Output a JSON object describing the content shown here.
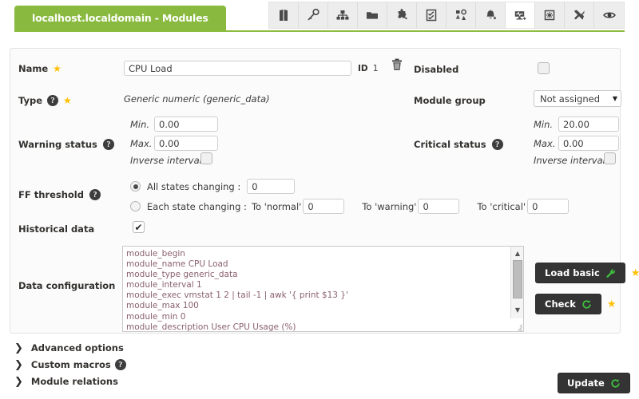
{
  "header": {
    "title": "localhost.localdomain - Modules",
    "accent_green": "#89ba3f",
    "toolbar_icons": [
      {
        "name": "bank-icon",
        "label": "Monitoring"
      },
      {
        "name": "key-icon",
        "label": "Credentials"
      },
      {
        "name": "network-icon",
        "label": "Network"
      },
      {
        "name": "folder-icon",
        "label": "Resources"
      },
      {
        "name": "puzzle-icon",
        "label": "Extensions"
      },
      {
        "name": "checklist-icon",
        "label": "Tasks"
      },
      {
        "name": "servers-alert-icon",
        "label": "Alerts"
      },
      {
        "name": "bell-plus-icon",
        "label": "Add alert"
      },
      {
        "name": "monitor-plus-icon",
        "label": "Add module",
        "active": true
      },
      {
        "name": "gear-box-icon",
        "label": "Setup"
      },
      {
        "name": "tools-icon",
        "label": "Tools"
      },
      {
        "name": "eye-icon",
        "label": "View"
      }
    ]
  },
  "form": {
    "name": {
      "label": "Name",
      "required_star": "★",
      "value": "CPU Load",
      "placeholder": "",
      "id_label": "ID",
      "id_value": "1",
      "delete_icon": "trash-icon"
    },
    "disabled": {
      "label": "Disabled",
      "checked": false
    },
    "type": {
      "label": "Type",
      "help": "?",
      "required_star": "★",
      "value": "Generic numeric (generic_data)"
    },
    "module_group": {
      "label": "Module group",
      "value": "Not assigned",
      "arrow": "▼"
    },
    "warning_status": {
      "label": "Warning status",
      "help": "?",
      "min_label": "Min.",
      "min_value": "0.00",
      "max_label": "Max.",
      "max_value": "0.00",
      "inverse_label": "Inverse interval",
      "inverse_checked": false
    },
    "critical_status": {
      "label": "Critical status",
      "help": "?",
      "min_label": "Min.",
      "min_value": "20.00",
      "max_label": "Max.",
      "max_value": "0.00",
      "inverse_label": "Inverse interval",
      "inverse_checked": false
    },
    "ff_threshold": {
      "label": "FF threshold",
      "help": "?",
      "all_states_label": "All states changing :",
      "all_states_value": "0",
      "all_states_selected": true,
      "each_state_label": "Each state changing :",
      "each_state_selected": false,
      "to_normal_label": "To 'normal'",
      "to_normal_value": "0",
      "to_warning_label": "To 'warning'",
      "to_warning_value": "0",
      "to_critical_label": "To 'critical'",
      "to_critical_value": "0"
    },
    "historical_data": {
      "label": "Historical data",
      "checked": true,
      "tick": "✔"
    },
    "data_configuration": {
      "label": "Data configuration",
      "value": "module_begin\nmodule_name CPU Load\nmodule_type generic_data\nmodule_interval 1\nmodule_exec vmstat 1 2 | tail -1 | awk '{ print $13 }'\nmodule_max 100\nmodule_min 0\nmodule_description User CPU Usage (%)",
      "scroll_up_arrow": "▲",
      "scroll_down_arrow": "▼"
    },
    "load_basic_button": {
      "label": "Load basic",
      "icon": "wrench-icon",
      "star": "★"
    },
    "check_button": {
      "label": "Check",
      "icon": "refresh-icon",
      "star": "★"
    }
  },
  "accordions": [
    {
      "label": "Advanced options",
      "chevron": "❯",
      "help": null
    },
    {
      "label": "Custom macros",
      "chevron": "❯",
      "help": "?"
    },
    {
      "label": "Module relations",
      "chevron": "❯",
      "help": null
    }
  ],
  "footer": {
    "update_button": {
      "label": "Update",
      "icon": "refresh-icon"
    }
  },
  "colors": {
    "accent": "#89ba3f",
    "star": "#ffc000",
    "button_dark": "#343434",
    "green_icon": "#33b535",
    "textarea_text": "#8a6070"
  }
}
